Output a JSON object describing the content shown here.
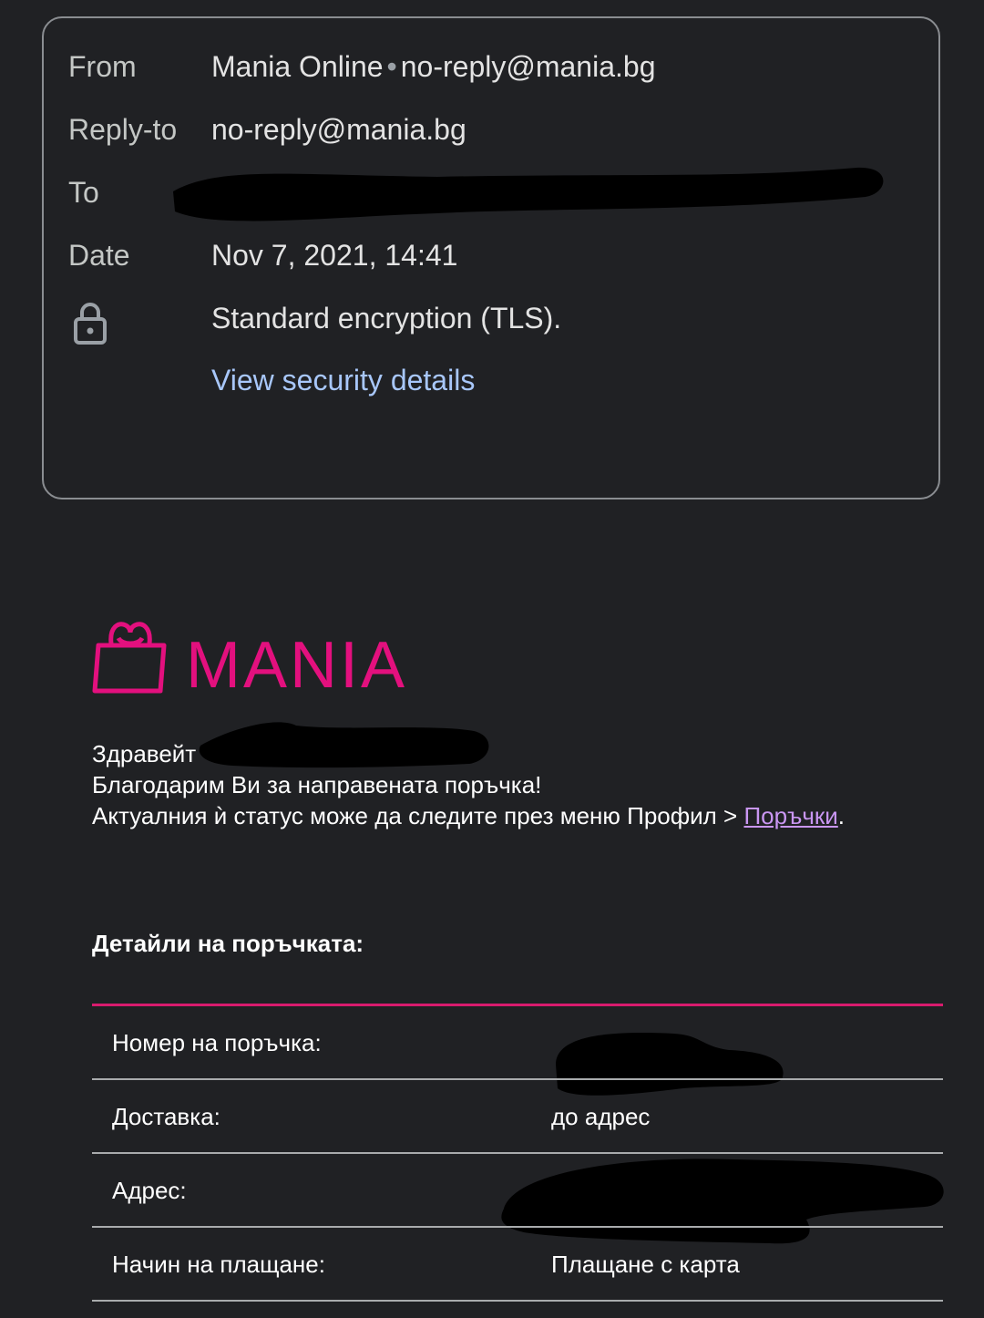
{
  "header": {
    "from_label": "From",
    "from_name": "Mania Online",
    "from_separator": "•",
    "from_email": "no-reply@mania.bg",
    "reply_to_label": "Reply-to",
    "reply_to_value": "no-reply@mania.bg",
    "to_label": "To",
    "date_label": "Date",
    "date_value": "Nov 7, 2021, 14:41",
    "encryption_text": "Standard encryption (TLS).",
    "security_link": "View security details"
  },
  "email": {
    "logo_text": "MANIA",
    "greeting": "Здравейт",
    "thanks": "Благодарим Ви за направената поръчка!",
    "status_prefix": "Актуалния ѝ статус може да следите през меню Профил > ",
    "status_link": "Поръчки",
    "status_suffix": ".",
    "details_title": "Детайли на поръчката:",
    "rows": [
      {
        "label": "Номер на поръчка:",
        "value": ""
      },
      {
        "label": "Доставка:",
        "value": "до адрес"
      },
      {
        "label": "Адрес:",
        "value": ""
      },
      {
        "label": "Начин на плащане:",
        "value": "Плащане с карта"
      }
    ]
  },
  "colors": {
    "brand": "#e3107e",
    "link_blue": "#a8c7fa",
    "link_purple": "#c996f2",
    "background": "#202124"
  },
  "icons": [
    "lock-icon",
    "mania-bag-logo-icon"
  ]
}
